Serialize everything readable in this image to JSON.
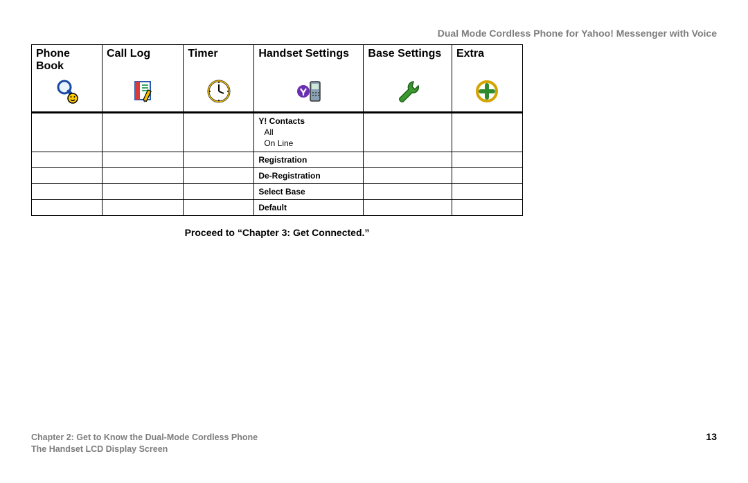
{
  "header": {
    "title": "Dual Mode Cordless Phone for Yahoo! Messenger with Voice"
  },
  "table": {
    "columns": [
      {
        "label": "Phone Book",
        "icon": "magnifier-smiley-icon"
      },
      {
        "label": "Call Log",
        "icon": "note-pencil-icon"
      },
      {
        "label": "Timer",
        "icon": "clock-icon"
      },
      {
        "label": "Handset Settings",
        "icon": "yahoo-phone-icon"
      },
      {
        "label": "Base Settings",
        "icon": "wrench-icon"
      },
      {
        "label": "Extra",
        "icon": "plus-circle-icon"
      }
    ],
    "rows": [
      {
        "c4_main": "Y! Contacts",
        "c4_sub1": "All",
        "c4_sub2": "On Line"
      },
      {
        "c4_main": "Registration"
      },
      {
        "c4_main": "De-Registration"
      },
      {
        "c4_main": "Select Base"
      },
      {
        "c4_main": "Default"
      }
    ]
  },
  "proceed": "Proceed to “Chapter 3: Get Connected.”",
  "footer": {
    "chapter": "Chapter 2: Get to Know the Dual-Mode Cordless Phone",
    "section": "The Handset LCD Display Screen",
    "page": "13"
  }
}
